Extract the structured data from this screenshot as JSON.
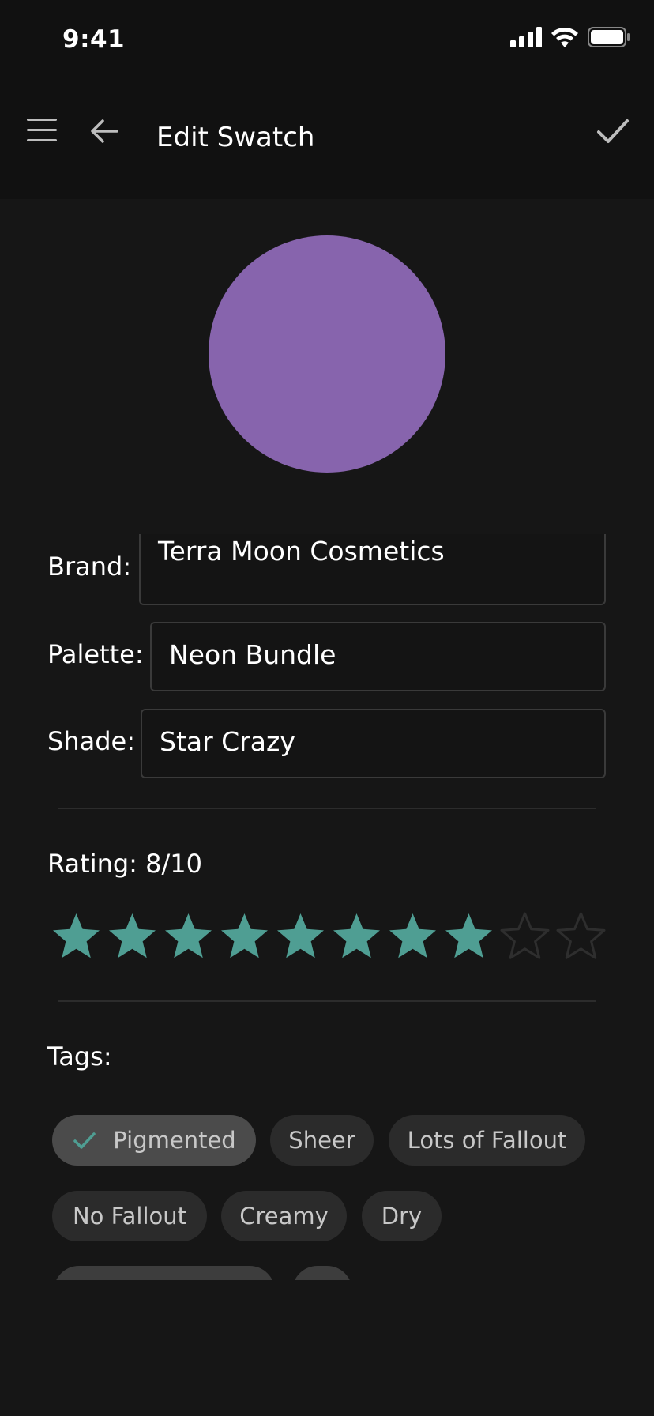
{
  "status_bar": {
    "time": "9:41"
  },
  "app_bar": {
    "title": "Edit Swatch"
  },
  "swatch": {
    "color": "#8764ad"
  },
  "form": {
    "brand_label": "Brand:",
    "brand_value": "Terra Moon Cosmetics",
    "palette_label": "Palette:",
    "palette_value": "Neon Bundle",
    "shade_label": "Shade:",
    "shade_value": "Star Crazy"
  },
  "rating": {
    "label": "Rating: 8/10",
    "value": 8,
    "max": 10,
    "filled_color": "#4f9e93",
    "empty_color": "#2e2e2e"
  },
  "tags": {
    "label": "Tags:",
    "items": [
      {
        "label": "Pigmented",
        "selected": true
      },
      {
        "label": "Sheer",
        "selected": false
      },
      {
        "label": "Lots of Fallout",
        "selected": false
      },
      {
        "label": "No Fallout",
        "selected": false
      },
      {
        "label": "Creamy",
        "selected": false
      },
      {
        "label": "Dry",
        "selected": false
      }
    ]
  },
  "colors": {
    "accent": "#4f9e93",
    "background": "#161616",
    "bar": "#111111"
  }
}
